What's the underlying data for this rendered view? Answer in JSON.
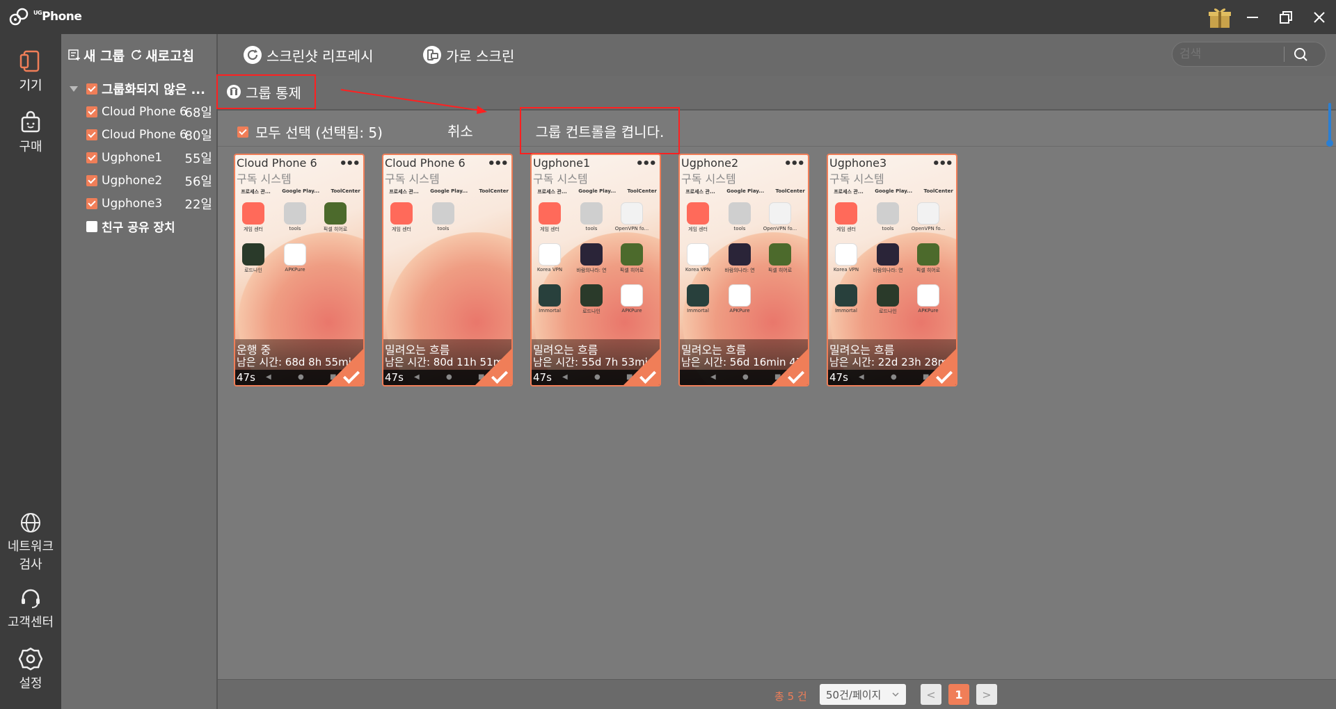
{
  "app": {
    "brand": "Phone",
    "brand_prefix": "UG"
  },
  "nav": [
    {
      "label": "기기",
      "icon": "phone-icon"
    },
    {
      "label": "구매",
      "icon": "shopping-bag-icon"
    },
    {
      "label": "네트워크\n검사",
      "label_line1": "네트워크",
      "label_line2": "검사",
      "icon": "globe-icon"
    },
    {
      "label": "고객센터",
      "icon": "headset-icon"
    },
    {
      "label": "설정",
      "icon": "gear-icon"
    }
  ],
  "sidebar": {
    "new_group": "새 그룹",
    "refresh": "새로고침",
    "group_name": "그룹화되지 않은 ...",
    "devices": [
      {
        "name": "Cloud Phone 6",
        "days": "68일"
      },
      {
        "name": "Cloud Phone 6",
        "days": "80일"
      },
      {
        "name": "Ugphone1",
        "days": "55일"
      },
      {
        "name": "Ugphone2",
        "days": "56일"
      },
      {
        "name": "Ugphone3",
        "days": "22일"
      }
    ],
    "shared": "친구 공유 장치"
  },
  "toolbar": {
    "screenshot_refresh": "스크린샷 리프레시",
    "landscape": "가로 스크린",
    "search_placeholder": "검색"
  },
  "control": {
    "group_control": "그룹 통제",
    "select_all": "모두 선택 (선택됨:  5)",
    "cancel": "취소",
    "notice": "그룹 컨트롤을 켭니다."
  },
  "card_common": {
    "subtitle": "구독 시스템",
    "top_apps": [
      "프로세스 관...",
      "Google Play...",
      "ToolCenter"
    ],
    "more": "•••"
  },
  "cards": [
    {
      "title": "Cloud Phone 6",
      "status": "운행 중",
      "remaining": "남은 시간: 68d 8h 55min",
      "seconds": "47s",
      "apps": [
        "게임 센터",
        "tools",
        "픽셀 히어로",
        "로드나인",
        "APKPure"
      ]
    },
    {
      "title": "Cloud Phone 6",
      "status": "밀려오는 흐름",
      "remaining": "남은 시간: 80d 11h 51min",
      "seconds": "47s",
      "apps": [
        "게임 센터",
        "tools"
      ]
    },
    {
      "title": "Ugphone1",
      "status": "밀려오는 흐름",
      "remaining": "남은 시간: 55d 7h 53min",
      "seconds": "47s",
      "apps": [
        "게임 센터",
        "tools",
        "OpenVPN fo...",
        "Korea VPN",
        "바람의나라: 연",
        "픽셀 히어로",
        "Immortal",
        "로드나인",
        "APKPure"
      ]
    },
    {
      "title": "Ugphone2",
      "status": "밀려오는 흐름",
      "remaining": "남은 시간: 56d 16min 47s",
      "seconds": "",
      "apps": [
        "게임 센터",
        "tools",
        "OpenVPN fo...",
        "Korea VPN",
        "바람의나라: 연",
        "픽셀 히어로",
        "Immortal",
        "APKPure"
      ]
    },
    {
      "title": "Ugphone3",
      "status": "밀려오는 흐름",
      "remaining": "남은 시간: 22d 23h 28min",
      "seconds": "47s",
      "apps": [
        "게임 센터",
        "tools",
        "OpenVPN fo...",
        "Korea VPN",
        "바람의나라: 연",
        "픽셀 히어로",
        "Immortal",
        "로드나인",
        "APKPure"
      ]
    }
  ],
  "footer": {
    "total": "총 5 건",
    "page_size": "50건/페이지",
    "prev": "<",
    "current_page": "1",
    "next": ">"
  },
  "colors": {
    "accent": "#f07e58",
    "highlight_box": "#ff2020"
  }
}
